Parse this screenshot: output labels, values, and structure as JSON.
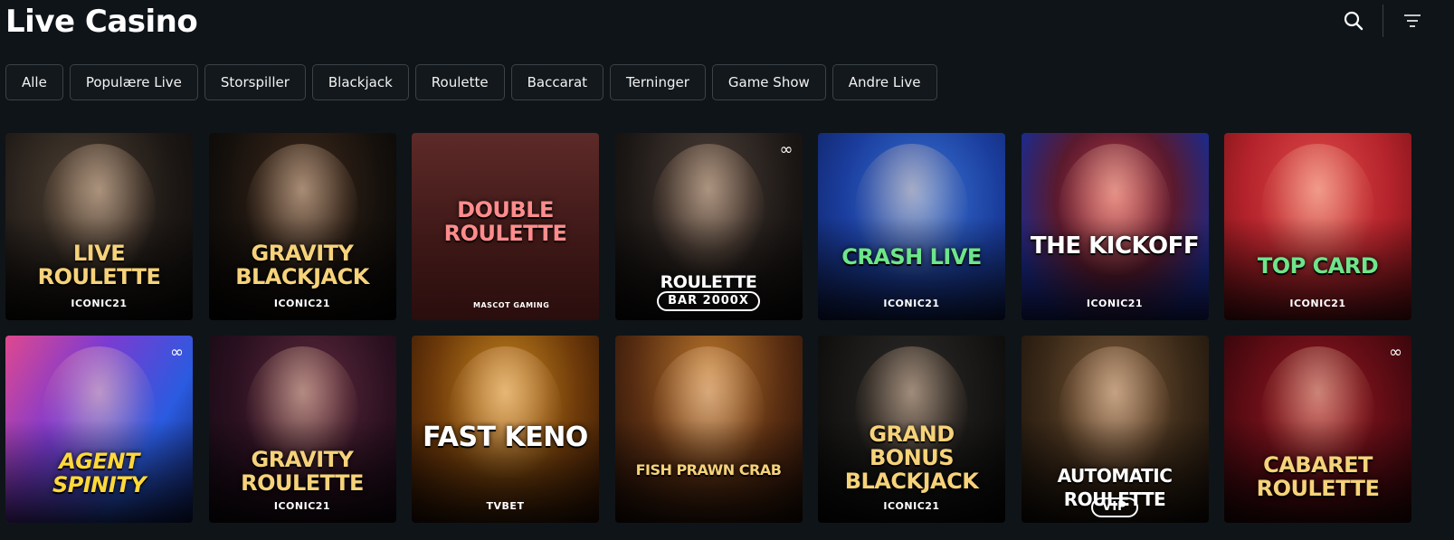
{
  "page": {
    "title": "Live Casino"
  },
  "colors": {
    "background": "#0f1418",
    "chip_border": "#3b4248",
    "chip_bg": "#12181c"
  },
  "header": {
    "search_icon": "search-icon",
    "filter_icon": "filter-icon"
  },
  "filters": [
    {
      "label": "Alle"
    },
    {
      "label": "Populære Live"
    },
    {
      "label": "Storspiller"
    },
    {
      "label": "Blackjack"
    },
    {
      "label": "Roulette"
    },
    {
      "label": "Baccarat"
    },
    {
      "label": "Terninger"
    },
    {
      "label": "Game Show"
    },
    {
      "label": "Andre Live"
    }
  ],
  "games": [
    {
      "title": "LIVE ROULETTE",
      "provider": "ICONIC21",
      "badge": ""
    },
    {
      "title": "GRAVITY BLACKJACK",
      "provider": "ICONIC21",
      "badge": ""
    },
    {
      "title": "DOUBLE ROULETTE",
      "provider": "MASCOT GAMING",
      "badge": ""
    },
    {
      "title": "ROULETTE",
      "provider": "",
      "badge": "BAR 2000X"
    },
    {
      "title": "CRASH Live",
      "provider": "ICONIC21",
      "badge": ""
    },
    {
      "title": "THE KICKOFF",
      "provider": "ICONIC21",
      "badge": ""
    },
    {
      "title": "TOP CARD",
      "provider": "ICONIC21",
      "badge": ""
    },
    {
      "title": "AGENT SPINITY",
      "provider": "",
      "badge": ""
    },
    {
      "title": "GRAVITY ROULETTE",
      "provider": "ICONIC21",
      "badge": ""
    },
    {
      "title": "FAST KENO",
      "provider": "TVBET",
      "badge": ""
    },
    {
      "title": "FISH PRAWN CRAB",
      "provider": "",
      "badge": ""
    },
    {
      "title": "GRAND BONUS BLACKJACK",
      "provider": "ICONIC21",
      "badge": ""
    },
    {
      "title": "AUTOMATIC ROULETTE",
      "provider": "",
      "badge": "VIP"
    },
    {
      "title": "CABARET ROULETTE",
      "provider": "",
      "badge": ""
    }
  ]
}
